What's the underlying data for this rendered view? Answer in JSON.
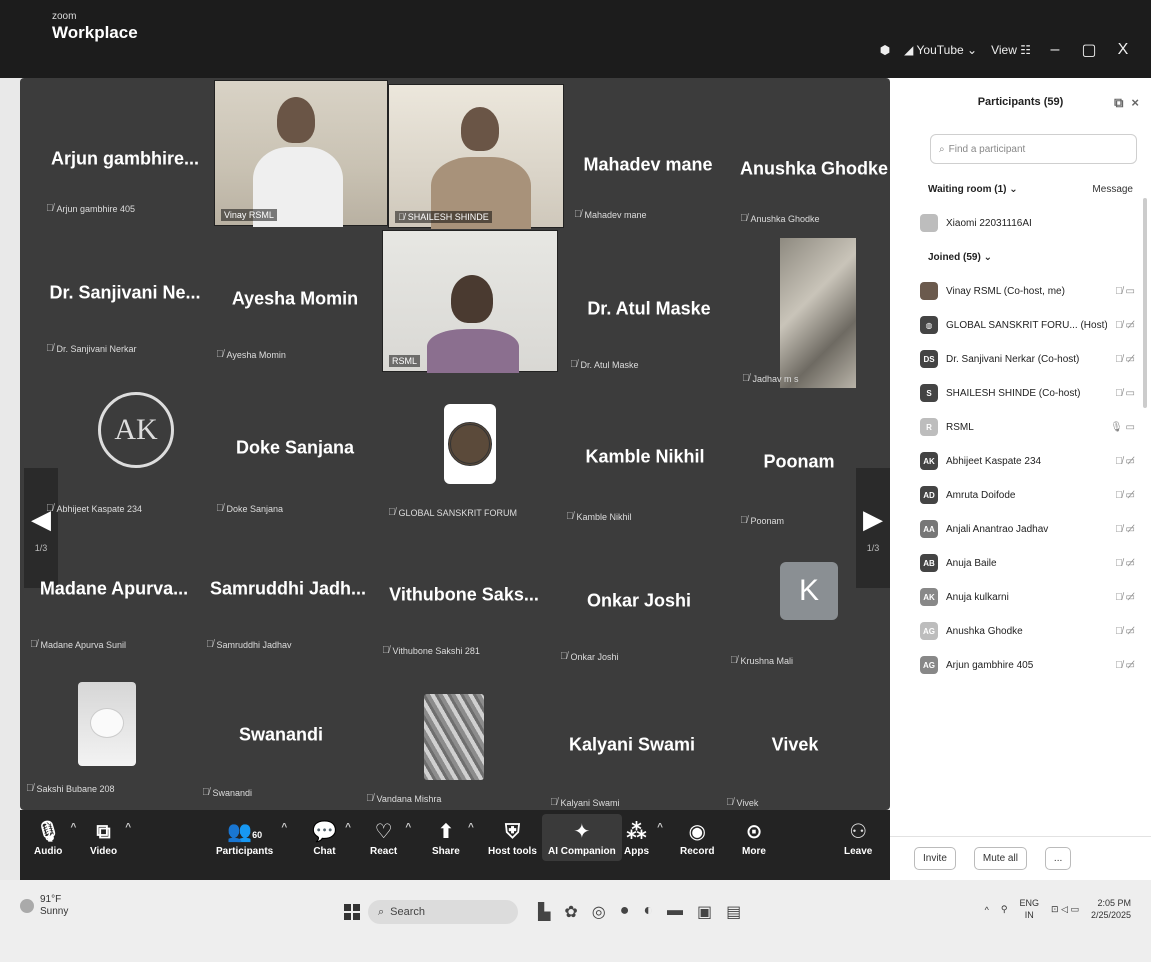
{
  "window": {
    "brand_small": "zoom",
    "brand_big": "Workplace",
    "youtube_label": "YouTube",
    "view_label": "View",
    "minimize_glyph": "–",
    "maximize_glyph": "▢",
    "close_glyph": "X"
  },
  "grid": {
    "page_left": "1/3",
    "page_right": "1/3",
    "tiles": [
      {
        "name": "Arjun gambhire...",
        "label": "Arjun gambhire 405"
      },
      {
        "name": "",
        "label": "Vinay RSML"
      },
      {
        "name": "",
        "label": "SHAILESH SHINDE"
      },
      {
        "name": "Mahadev mane",
        "label": "Mahadev mane"
      },
      {
        "name": "Anushka Ghodke",
        "label": "Anushka Ghodke"
      },
      {
        "name": "Dr. Sanjivani Ne...",
        "label": "Dr. Sanjivani Nerkar"
      },
      {
        "name": "Ayesha Momin",
        "label": "Ayesha Momin"
      },
      {
        "name": "",
        "label": "RSML"
      },
      {
        "name": "Dr. Atul Maske",
        "label": "Dr. Atul Maske"
      },
      {
        "name": "",
        "label": "Jadhav m s"
      },
      {
        "name": "",
        "label": "Abhijeet Kaspate 234",
        "logo": "AK"
      },
      {
        "name": "Doke Sanjana",
        "label": "Doke Sanjana"
      },
      {
        "name": "",
        "label": "GLOBAL SANSKRIT FORUM"
      },
      {
        "name": "Kamble Nikhil",
        "label": "Kamble Nikhil"
      },
      {
        "name": "Poonam",
        "label": "Poonam"
      },
      {
        "name": "Madane Apurva...",
        "label": "Madane Apurva Sunil"
      },
      {
        "name": "Samruddhi Jadh...",
        "label": "Samruddhi Jadhav"
      },
      {
        "name": "Vithubone Saks...",
        "label": "Vithubone Sakshi 281"
      },
      {
        "name": "Onkar Joshi",
        "label": "Onkar Joshi"
      },
      {
        "name": "",
        "label": "Krushna Mali",
        "avatar": "K"
      },
      {
        "name": "",
        "label": "Sakshi Bubane 208"
      },
      {
        "name": "Swanandi",
        "label": "Swanandi"
      },
      {
        "name": "",
        "label": "Vandana Mishra"
      },
      {
        "name": "Kalyani Swami",
        "label": "Kalyani Swami"
      },
      {
        "name": "Vivek",
        "label": "Vivek"
      }
    ]
  },
  "toolbar": {
    "audio": "Audio",
    "video": "Video",
    "participants": "Participants",
    "participants_count": "60",
    "chat": "Chat",
    "react": "React",
    "share": "Share",
    "host_tools": "Host tools",
    "ai_companion": "AI Companion",
    "apps": "Apps",
    "record": "Record",
    "more": "More",
    "leave": "Leave"
  },
  "panel": {
    "title": "Participants (59)",
    "search_placeholder": "Find a participant",
    "waiting_room": "Waiting room (1)",
    "message": "Message",
    "waiting": [
      {
        "name": "Xiaomi 22031116AI"
      }
    ],
    "joined": "Joined (59)",
    "participants": [
      {
        "initials": "",
        "name": "Vinay RSML (Co-host, me)"
      },
      {
        "initials": "",
        "name": "GLOBAL SANSKRIT FORU... (Host)"
      },
      {
        "initials": "DS",
        "name": "Dr. Sanjivani Nerkar (Co-host)"
      },
      {
        "initials": "S",
        "name": "SHAILESH SHINDE (Co-host)"
      },
      {
        "initials": "R",
        "name": "RSML"
      },
      {
        "initials": "AK",
        "name": "Abhijeet Kaspate 234"
      },
      {
        "initials": "AD",
        "name": "Amruta Doifode"
      },
      {
        "initials": "AA",
        "name": "Anjali Anantrao Jadhav"
      },
      {
        "initials": "AB",
        "name": "Anuja Baile"
      },
      {
        "initials": "AK",
        "name": "Anuja kulkarni"
      },
      {
        "initials": "AG",
        "name": "Anushka Ghodke"
      },
      {
        "initials": "AG",
        "name": "Arjun gambhire 405"
      }
    ],
    "invite": "Invite",
    "mute_all": "Mute all",
    "more": "..."
  },
  "taskbar": {
    "temperature": "91°F",
    "condition": "Sunny",
    "search": "Search",
    "lang_top": "ENG",
    "lang_bottom": "IN",
    "time": "2:05 PM",
    "date": "2/25/2025"
  }
}
